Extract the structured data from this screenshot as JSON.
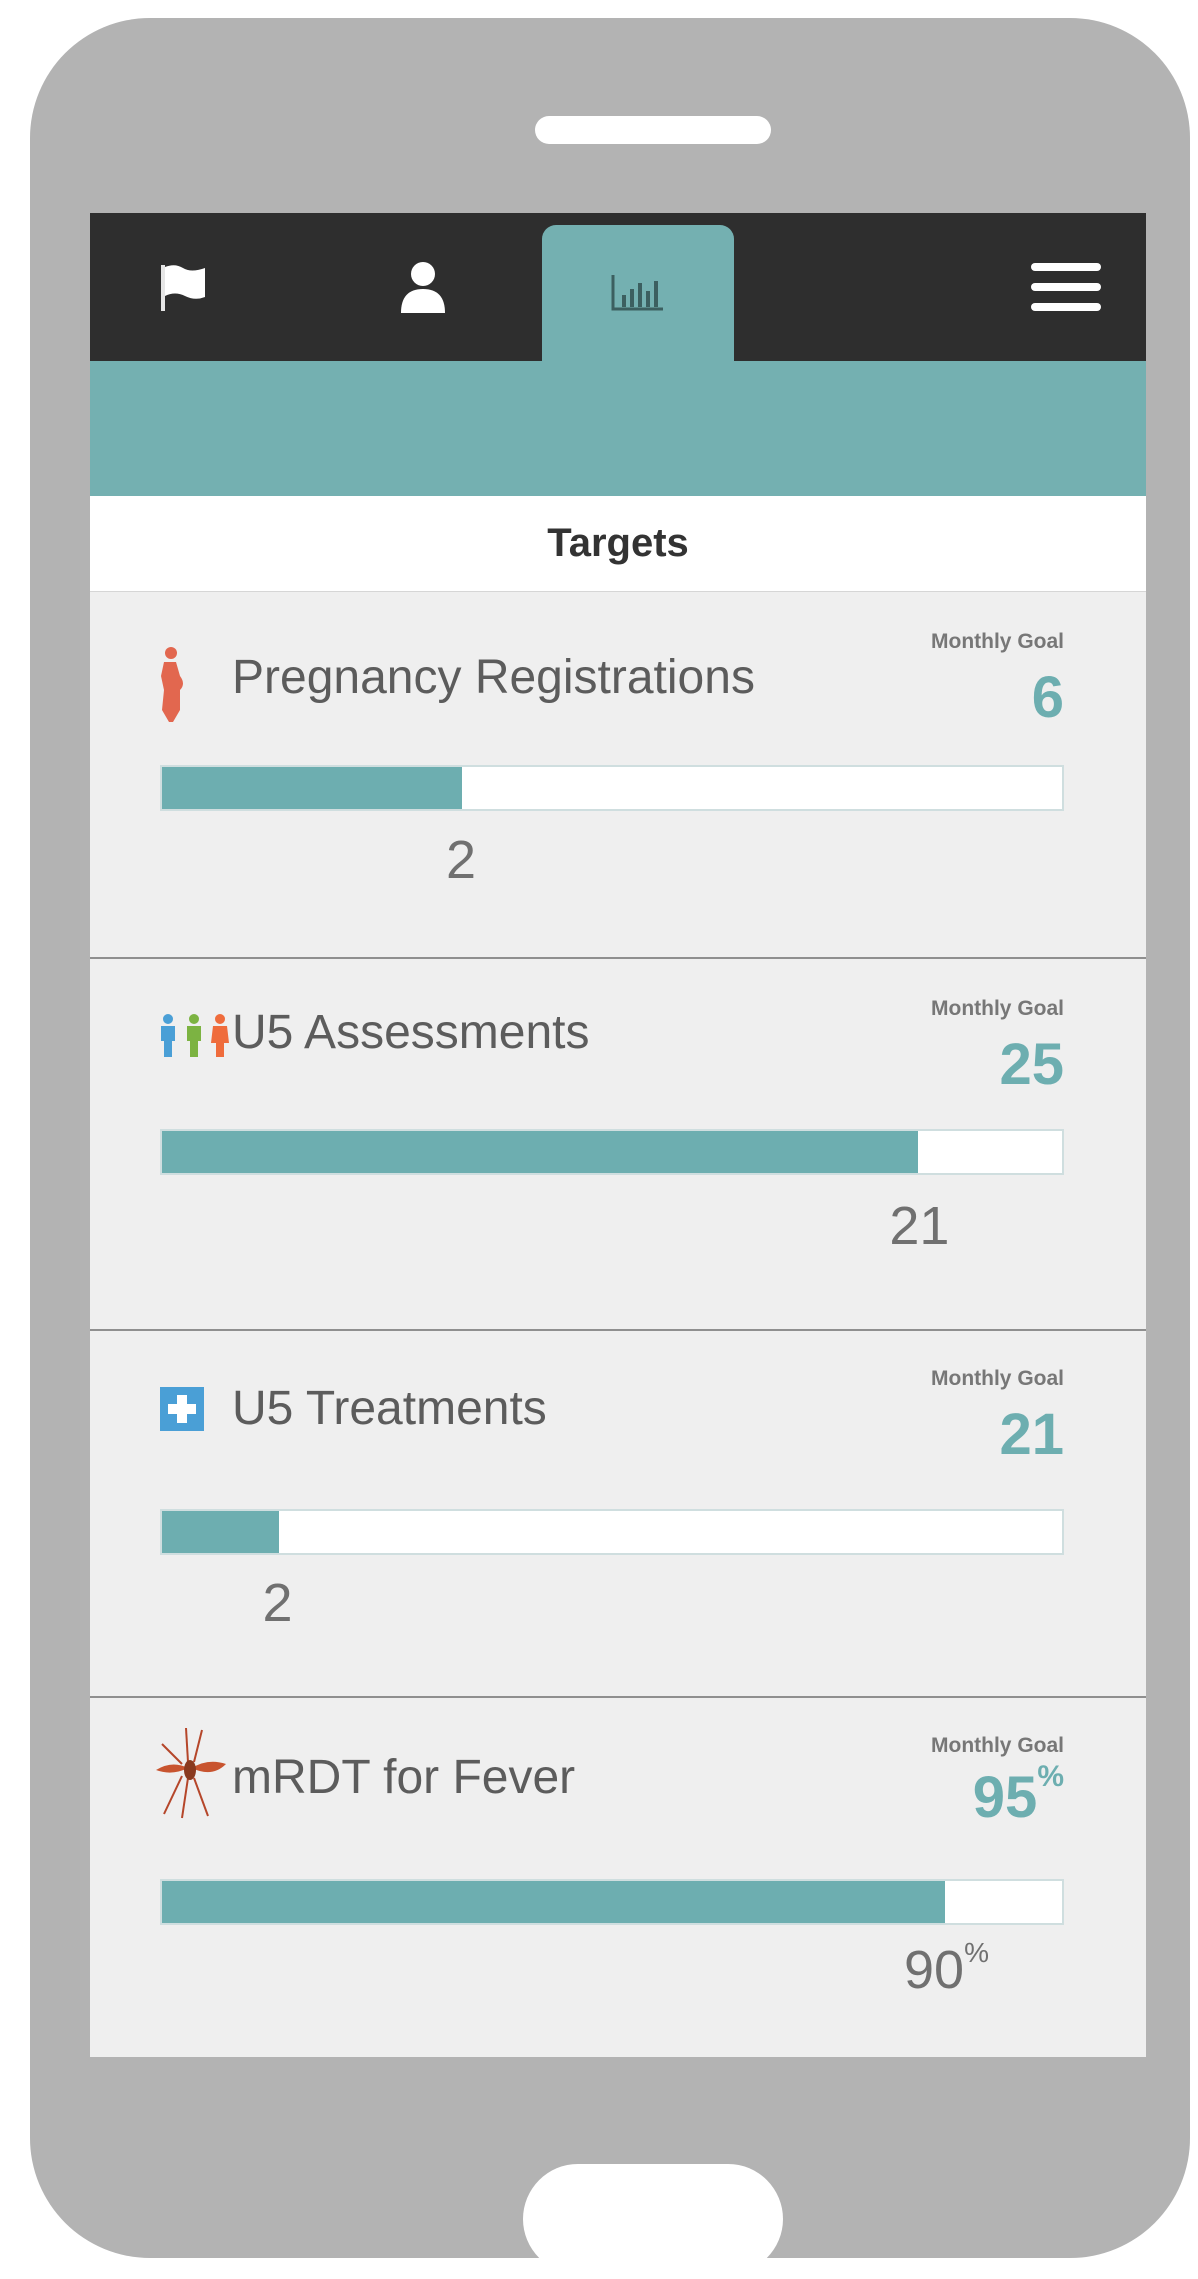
{
  "nav": {
    "tabs": [
      {
        "icon": "flag-icon",
        "active": false
      },
      {
        "icon": "person-icon",
        "active": false
      },
      {
        "icon": "bar-chart-icon",
        "active": true
      }
    ],
    "menu_icon": "hamburger-menu-icon"
  },
  "page": {
    "title": "Targets"
  },
  "colors": {
    "accent": "#74b0b1",
    "navbar": "#2e2e2e",
    "phone_body": "#b3b3b3"
  },
  "targets": [
    {
      "title": "Pregnancy Registrations",
      "icon": "pregnant-woman-icon",
      "goal_label": "Monthly Goal",
      "goal": "6",
      "goal_unit": "",
      "count": "2",
      "count_unit": "",
      "progress": 0.333
    },
    {
      "title": "U5 Assessments",
      "icon": "children-group-icon",
      "goal_label": "Monthly Goal",
      "goal": "25",
      "goal_unit": "",
      "count": "21",
      "count_unit": "",
      "progress": 0.84
    },
    {
      "title": "U5 Treatments",
      "icon": "medical-cross-icon",
      "goal_label": "Monthly Goal",
      "goal": "21",
      "goal_unit": "",
      "count": "2",
      "count_unit": "",
      "progress": 0.13
    },
    {
      "title": "mRDT for Fever",
      "icon": "mosquito-icon",
      "goal_label": "Monthly Goal",
      "goal": "95",
      "goal_unit": "%",
      "count": "90",
      "count_unit": "%",
      "progress": 0.87
    }
  ]
}
